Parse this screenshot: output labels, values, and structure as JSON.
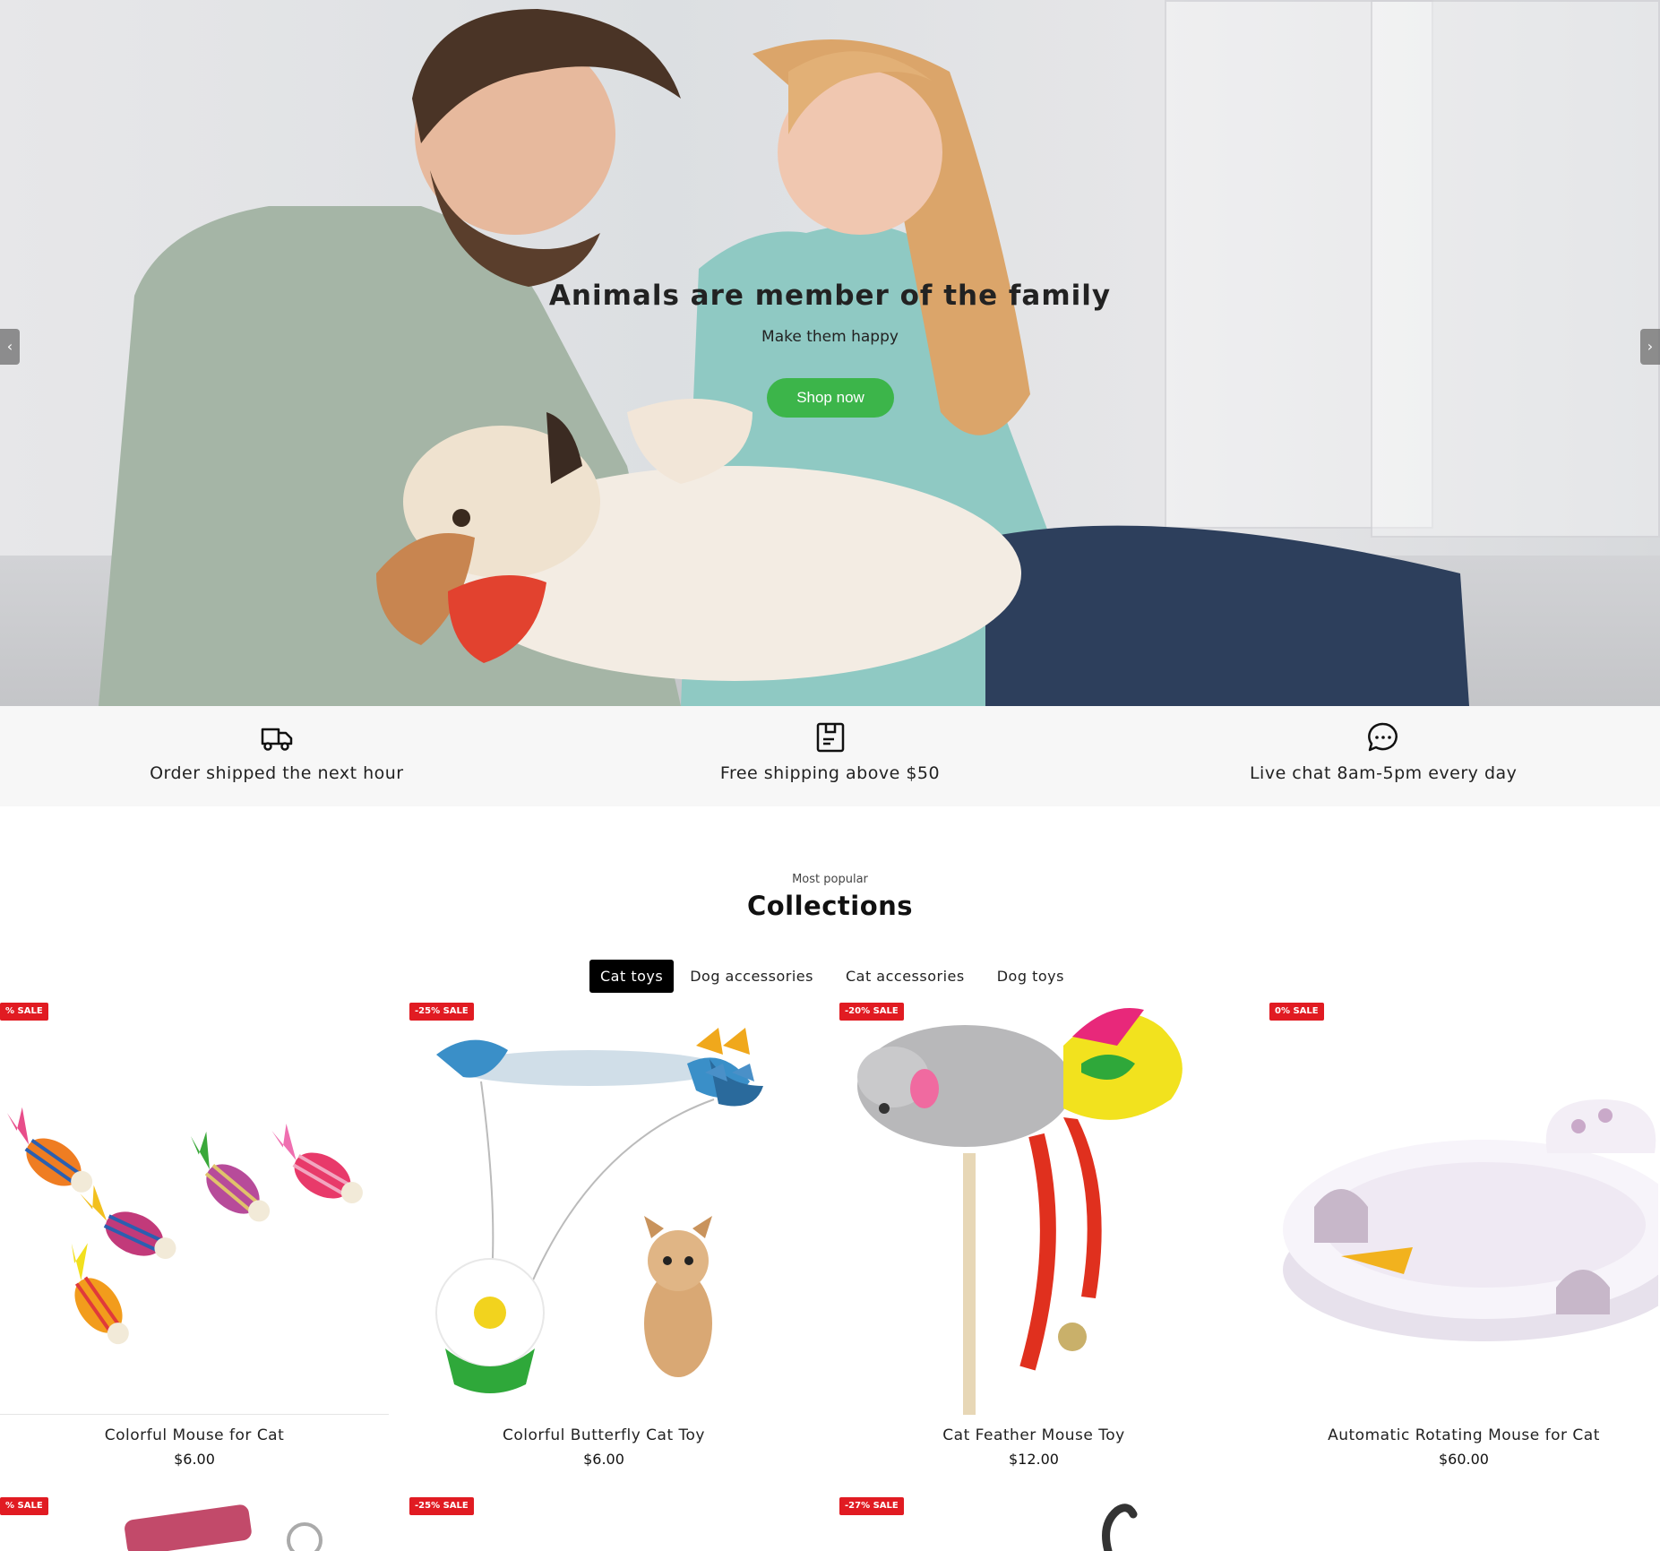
{
  "hero": {
    "title": "Animals are member of the family",
    "subtitle": "Make them happy",
    "cta_label": "Shop now",
    "prev_arrow": "‹",
    "next_arrow": "›",
    "accent_color": "#3cb54a"
  },
  "features": [
    {
      "icon": "truck-icon",
      "text": "Order shipped the next hour"
    },
    {
      "icon": "package-icon",
      "text": "Free shipping above $50"
    },
    {
      "icon": "chat-icon",
      "text": "Live chat 8am-5pm every day"
    }
  ],
  "collections": {
    "eyebrow": "Most popular",
    "title": "Collections",
    "tabs": [
      "Cat toys",
      "Dog accessories",
      "Cat accessories",
      "Dog toys"
    ],
    "active_tab": "Cat toys",
    "products": [
      {
        "badge": "% SALE",
        "name": "Colorful Mouse for Cat",
        "price": "$6.00"
      },
      {
        "badge": "-25% SALE",
        "name": "Colorful Butterfly Cat Toy",
        "price": "$6.00"
      },
      {
        "badge": "-20% SALE",
        "name": "Cat Feather Mouse Toy",
        "price": "$12.00"
      },
      {
        "badge": "0% SALE",
        "name": "Automatic Rotating Mouse for Cat",
        "price": "$60.00"
      }
    ],
    "next_row_badges": [
      "% SALE",
      "-25% SALE",
      "-27% SALE"
    ],
    "sale_color": "#e11b22"
  }
}
